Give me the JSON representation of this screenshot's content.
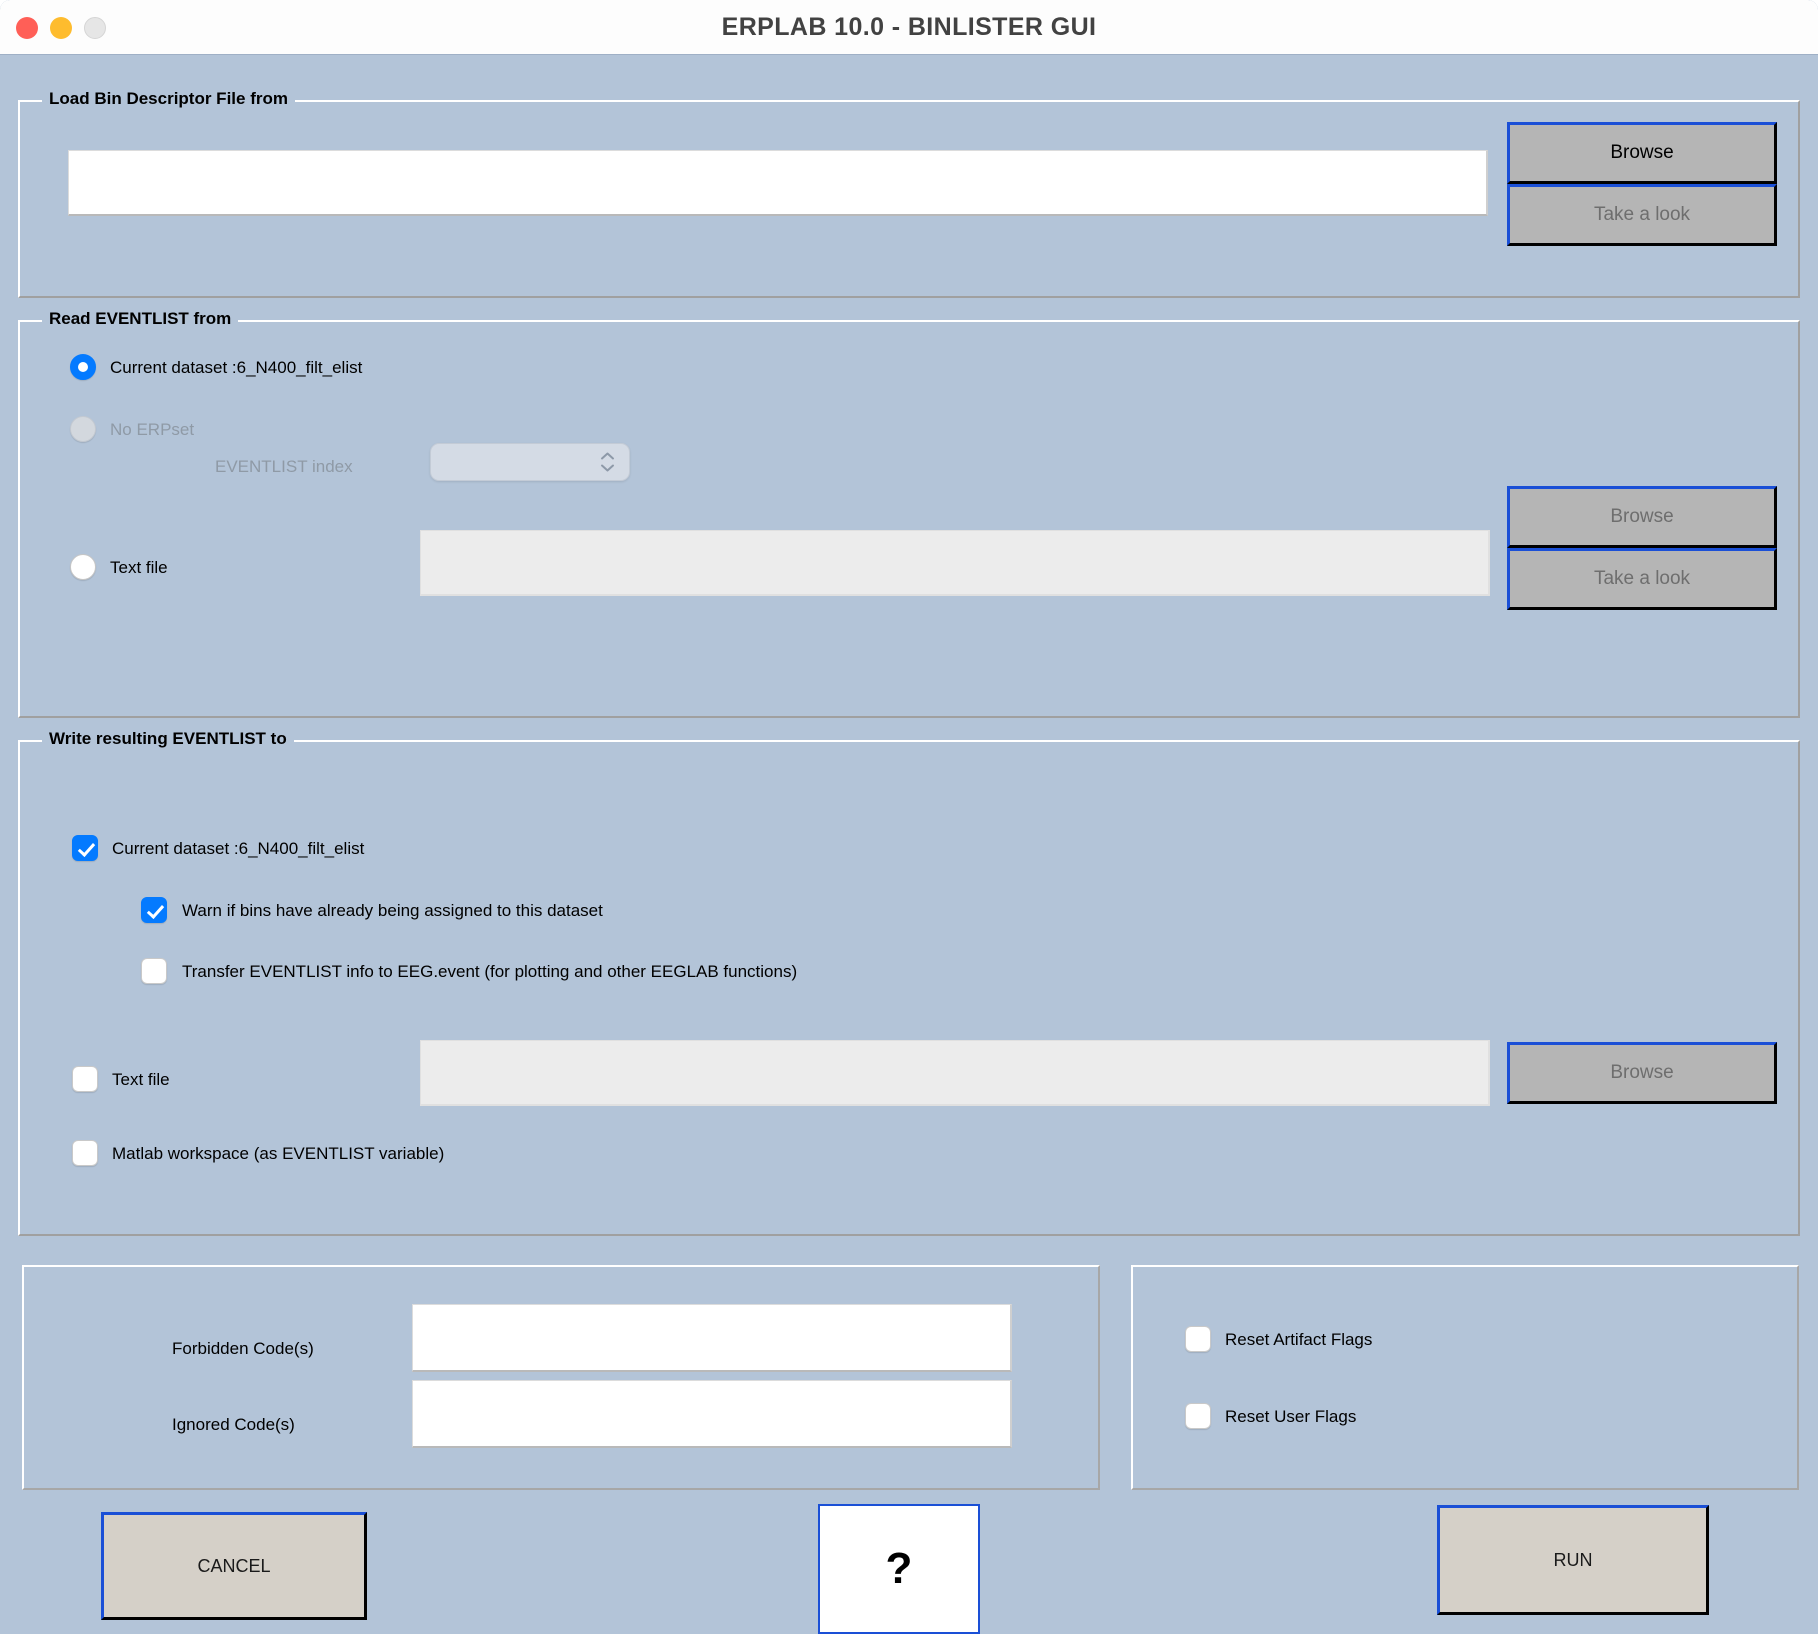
{
  "window": {
    "title": "ERPLAB 10.0  -   BINLISTER GUI",
    "traffic_lights": [
      "close-button",
      "minimize-button",
      "zoom-button"
    ],
    "accent_blue": "#047aff",
    "border_blue": "#1a4fd6",
    "panel_bg": "#b3c4d8",
    "button_gray": "#b5b5b5",
    "button_beige": "#d5d0c8"
  },
  "load_bdf": {
    "legend": "Load Bin Descriptor File from",
    "path_value": "",
    "path_placeholder": "",
    "browse_label": "Browse",
    "take_a_look_label": "Take a look"
  },
  "read_eventlist": {
    "legend": "Read EVENTLIST from",
    "current_dataset_prefix": "Current dataset :",
    "current_dataset_name": "6_N400_filt_elist",
    "no_erpset_label": "No ERPset",
    "eventlist_index_label": "EVENTLIST index",
    "eventlist_index_value": "",
    "text_file_label": "Text file",
    "text_file_value": "",
    "browse_label": "Browse",
    "take_a_look_label": "Take a look"
  },
  "write_eventlist": {
    "legend": "Write resulting EVENTLIST to",
    "current_dataset_prefix": "Current dataset :",
    "current_dataset_name": "6_N400_filt_elist",
    "warn_label": "Warn if bins have already being assigned to this dataset",
    "transfer_label": "Transfer EVENTLIST info to EEG.event (for plotting and other EEGLAB functions)",
    "text_file_label": "Text file",
    "text_file_value": "",
    "browse_label": "Browse",
    "matlab_workspace_label": "Matlab workspace (as EVENTLIST variable)"
  },
  "codes": {
    "forbidden_label": "Forbidden Code(s)",
    "forbidden_value": "",
    "ignored_label": "Ignored Code(s)",
    "ignored_value": ""
  },
  "flags": {
    "reset_artifact_label": "Reset Artifact Flags",
    "reset_user_label": "Reset User Flags"
  },
  "actions": {
    "cancel_label": "CANCEL",
    "help_label": "?",
    "run_label": "RUN"
  }
}
